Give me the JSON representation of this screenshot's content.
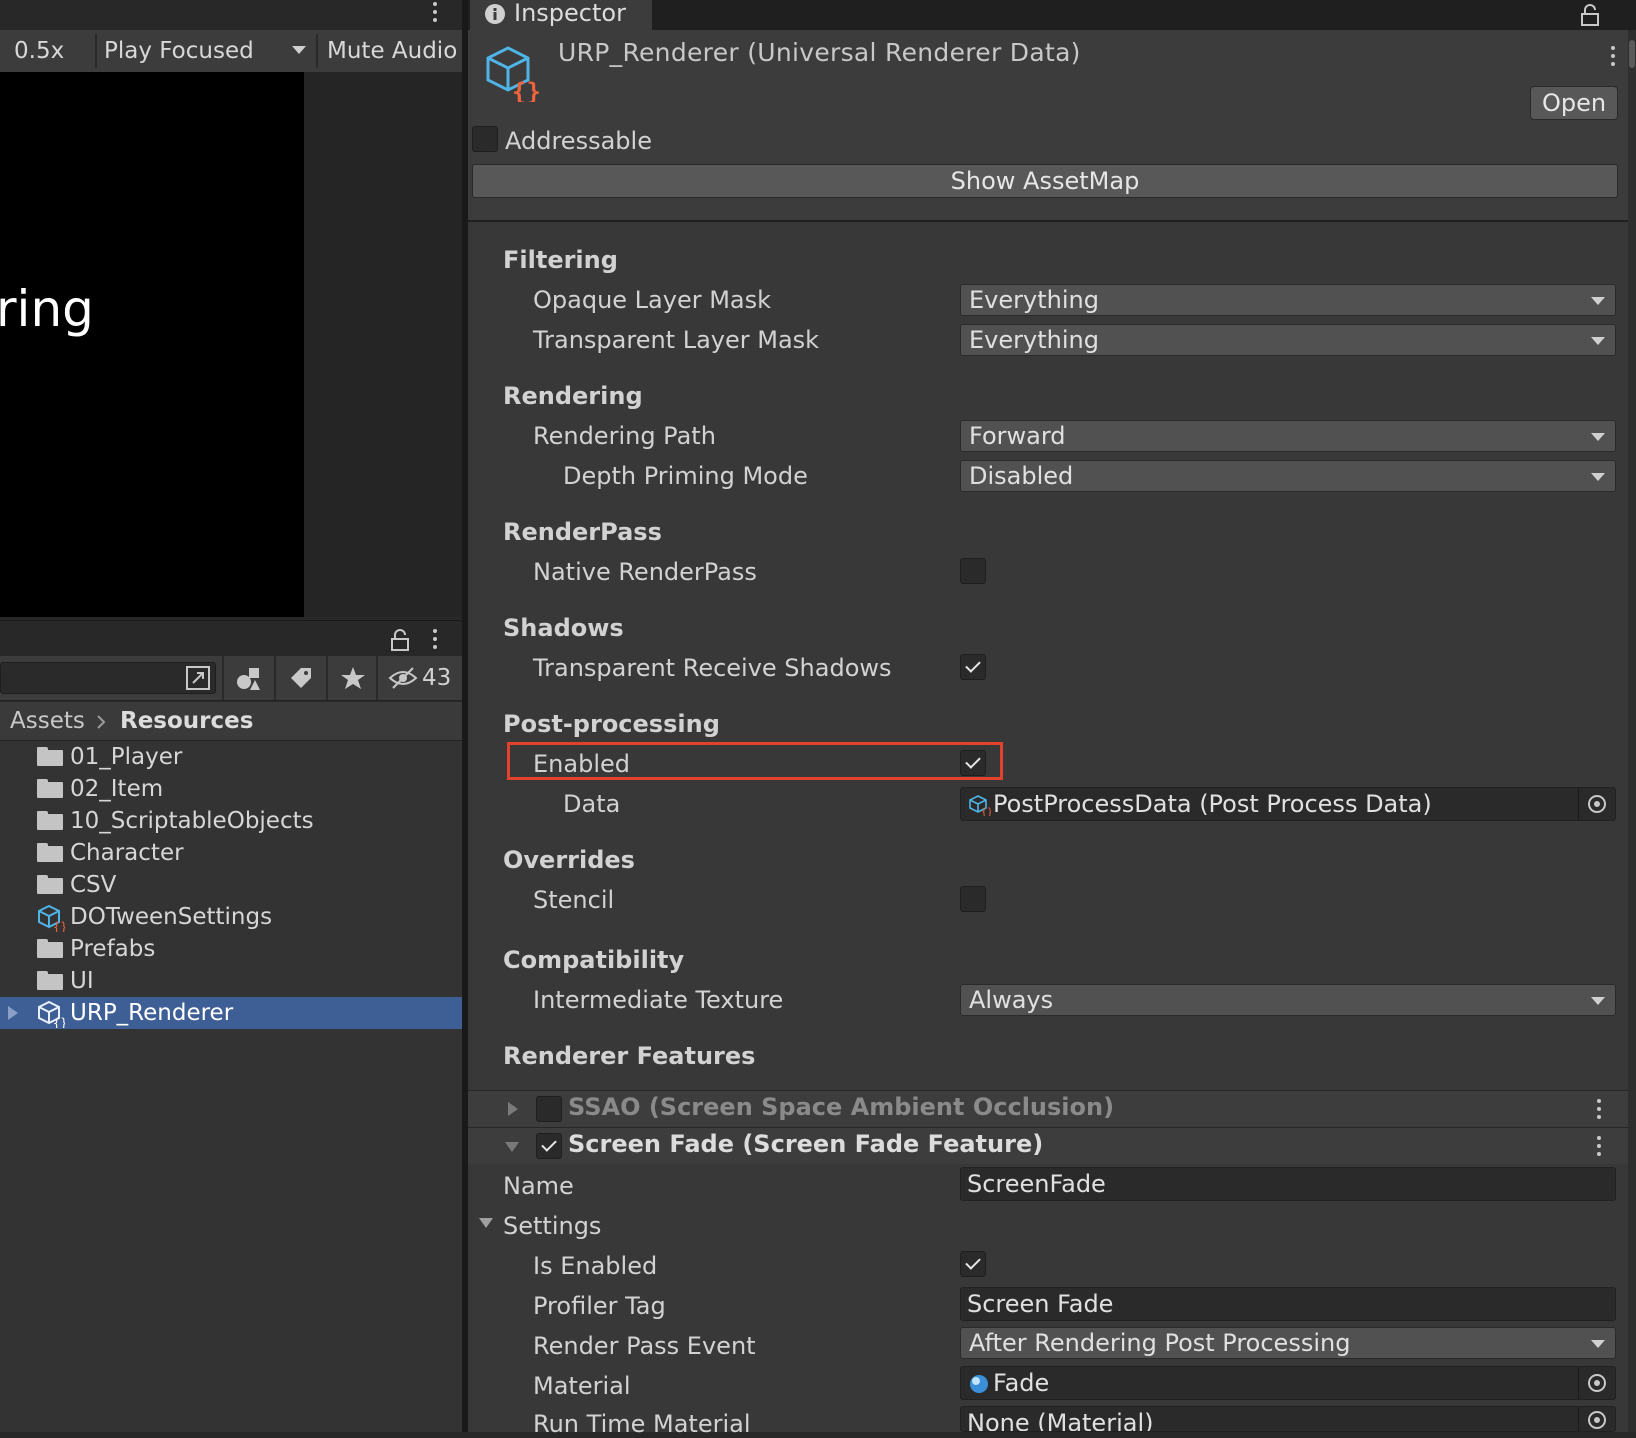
{
  "game": {
    "toolbar": {
      "scale": "0.5x",
      "play_mode": "Play Focused",
      "mute": "Mute Audio"
    },
    "viewport_text": "ring"
  },
  "project": {
    "hidden_count": "43",
    "breadcrumb": {
      "root": "Assets",
      "current": "Resources"
    },
    "items": [
      {
        "label": "01_Player",
        "icon": "folder-icon"
      },
      {
        "label": "02_Item",
        "icon": "folder-icon"
      },
      {
        "label": "10_ScriptableObjects",
        "icon": "folder-icon"
      },
      {
        "label": "Character",
        "icon": "folder-icon"
      },
      {
        "label": "CSV",
        "icon": "folder-icon"
      },
      {
        "label": "DOTweenSettings",
        "icon": "scriptable-object-icon"
      },
      {
        "label": "Prefabs",
        "icon": "folder-icon"
      },
      {
        "label": "UI",
        "icon": "folder-icon"
      },
      {
        "label": "URP_Renderer",
        "icon": "scriptable-object-icon",
        "selected": true
      }
    ]
  },
  "inspector": {
    "tab_label": "Inspector",
    "asset_title": "URP_Renderer (Universal Renderer Data)",
    "open_label": "Open",
    "addressable_label": "Addressable",
    "addressable_checked": false,
    "show_assetmap_label": "Show AssetMap",
    "sections": {
      "filtering": "Filtering",
      "rendering": "Rendering",
      "renderpass": "RenderPass",
      "shadows": "Shadows",
      "postprocessing": "Post-processing",
      "overrides": "Overrides",
      "compatibility": "Compatibility",
      "renderer_features": "Renderer Features"
    },
    "fields": {
      "opaque_mask": {
        "label": "Opaque Layer Mask",
        "value": "Everything"
      },
      "transparent_mask": {
        "label": "Transparent Layer Mask",
        "value": "Everything"
      },
      "rendering_path": {
        "label": "Rendering Path",
        "value": "Forward"
      },
      "depth_priming": {
        "label": "Depth Priming Mode",
        "value": "Disabled"
      },
      "native_renderpass": {
        "label": "Native RenderPass",
        "checked": false
      },
      "transparent_shadows": {
        "label": "Transparent Receive Shadows",
        "checked": true
      },
      "pp_enabled": {
        "label": "Enabled",
        "checked": true
      },
      "pp_data": {
        "label": "Data",
        "value": "PostProcessData (Post Process Data)"
      },
      "stencil": {
        "label": "Stencil",
        "checked": false
      },
      "intermediate_texture": {
        "label": "Intermediate Texture",
        "value": "Always"
      }
    },
    "features": [
      {
        "label": "SSAO (Screen Space Ambient Occlusion)",
        "checked": false,
        "expanded": false
      },
      {
        "label": "Screen Fade (Screen Fade Feature)",
        "checked": true,
        "expanded": true
      }
    ],
    "screen_fade": {
      "name": {
        "label": "Name",
        "value": "ScreenFade"
      },
      "settings_label": "Settings",
      "is_enabled": {
        "label": "Is Enabled",
        "checked": true
      },
      "profiler_tag": {
        "label": "Profiler Tag",
        "value": "Screen Fade"
      },
      "render_pass_event": {
        "label": "Render Pass Event",
        "value": "After Rendering Post Processing"
      },
      "material": {
        "label": "Material",
        "value": "Fade"
      },
      "runtime_material": {
        "label": "Run Time Material",
        "value": "None (Material)"
      }
    }
  },
  "colors": {
    "highlight": "#e2412c",
    "selection": "#3e5f96",
    "asset_icon": "#4fb4e6",
    "asset_brace": "#f0643c"
  }
}
